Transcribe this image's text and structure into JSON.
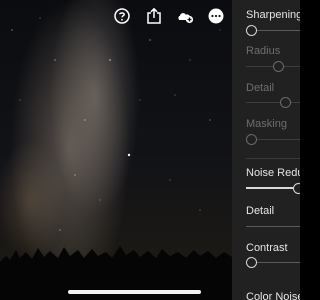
{
  "toolbar": {
    "icons": [
      "help-icon",
      "share-icon",
      "cloud-sync-icon",
      "more-icon"
    ]
  },
  "detail_panel": {
    "sharpening": {
      "label": "Sharpening",
      "value": 0,
      "radius": {
        "label": "Radius",
        "value": 0.33,
        "enabled": false
      },
      "detail": {
        "label": "Detail",
        "value": 0.5,
        "enabled": false
      },
      "masking": {
        "label": "Masking",
        "value": 0,
        "enabled": false
      }
    },
    "noise_reduction": {
      "label": "Noise Reduct",
      "value": 0.92,
      "detail": {
        "label": "Detail",
        "value": 0.5
      },
      "contrast": {
        "label": "Contrast",
        "value": 0
      }
    },
    "color_noise": {
      "label": "Color Noise R"
    }
  },
  "colors": {
    "panel": "#212121",
    "text": "#e6e6e6",
    "text_disabled": "#6e6e6e",
    "slider": "#d8d8d8"
  }
}
